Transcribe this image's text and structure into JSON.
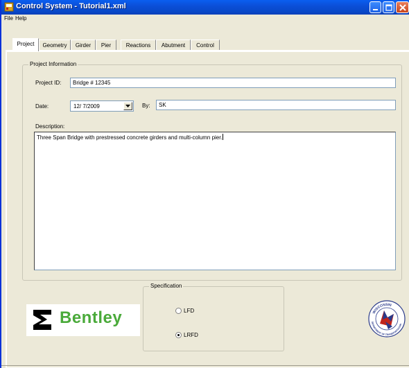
{
  "window": {
    "title": "Control System - Tutorial1.xml"
  },
  "menu": {
    "file": "File",
    "help": "Help"
  },
  "tabs": [
    {
      "label": "Project",
      "active": true
    },
    {
      "label": "Geometry",
      "active": false
    },
    {
      "label": "Girder",
      "active": false
    },
    {
      "label": "Pier",
      "active": false
    },
    {
      "label": "Reactions",
      "active": false
    },
    {
      "label": "Abutment",
      "active": false
    },
    {
      "label": "Control",
      "active": false
    }
  ],
  "project_info": {
    "group_title": "Project Information",
    "project_id_label": "Project ID:",
    "project_id_value": "Bridge # 12345",
    "date_label": "Date:",
    "date_value": "12/ 7/2009",
    "by_label": "By:",
    "by_value": "SK",
    "description_label": "Description:",
    "description_value": "Three Span Bridge with prestressed concrete girders and multi-column pier."
  },
  "specification": {
    "group_title": "Specification",
    "options": [
      {
        "label": "LFD",
        "selected": false
      },
      {
        "label": "LRFD",
        "selected": true
      }
    ]
  },
  "logos": {
    "bentley_text": "Bentley",
    "bentley_color": "#4aaa3a",
    "seal_top_text": "WISCONSIN",
    "seal_bottom_text": "DEPARTMENT OF TRANSPORTATION"
  },
  "colors": {
    "titlebar": "#0a5ff0",
    "window_bg": "#ece9d8",
    "input_border": "#7f9db9"
  }
}
